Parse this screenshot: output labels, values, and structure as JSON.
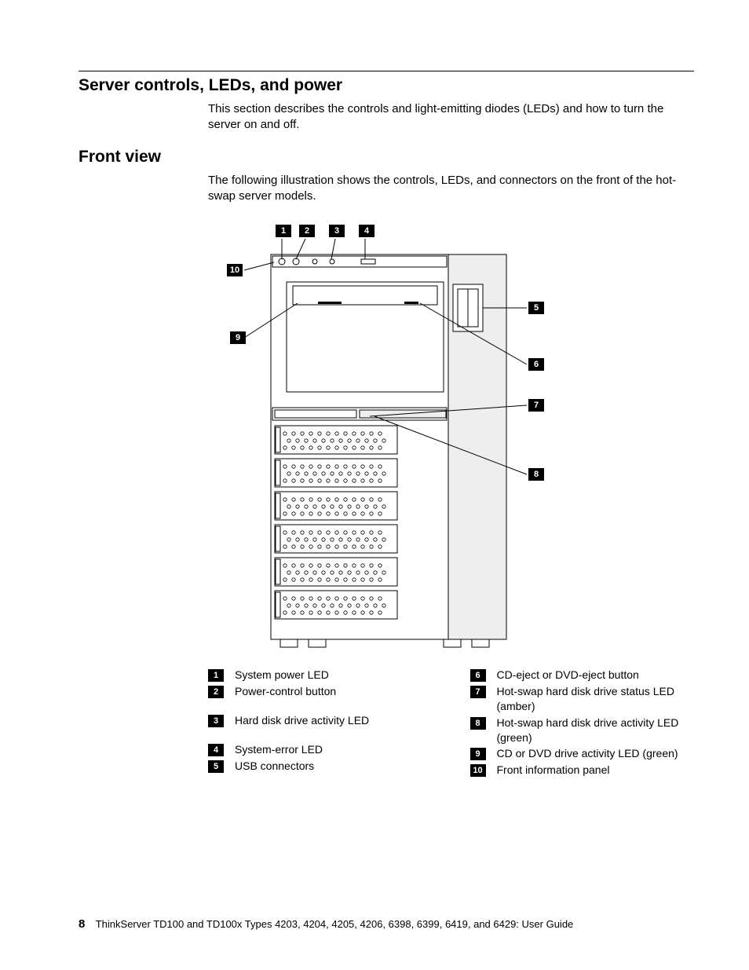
{
  "headings": {
    "h1": "Server controls, LEDs, and power",
    "h2": "Front view"
  },
  "paragraphs": {
    "p1": "This section describes the controls and light-emitting diodes (LEDs) and how to turn the server on and off.",
    "p2": "The following illustration shows the controls, LEDs, and connectors on the front of the hot-swap server models."
  },
  "callouts": {
    "c1": "1",
    "c2": "2",
    "c3": "3",
    "c4": "4",
    "c5": "5",
    "c6": "6",
    "c7": "7",
    "c8": "8",
    "c9": "9",
    "c10": "10"
  },
  "legend_left": [
    {
      "n": "1",
      "t": "System power LED"
    },
    {
      "n": "2",
      "t": "Power-control button"
    },
    {
      "n": "3",
      "t": "Hard disk drive activity LED"
    },
    {
      "n": "4",
      "t": "System-error LED"
    },
    {
      "n": "5",
      "t": "USB connectors"
    }
  ],
  "legend_right": [
    {
      "n": "6",
      "t": "CD-eject or DVD-eject button"
    },
    {
      "n": "7",
      "t": "Hot-swap hard disk drive status LED (amber)"
    },
    {
      "n": "8",
      "t": "Hot-swap hard disk drive activity LED (green)"
    },
    {
      "n": "9",
      "t": "CD or DVD drive activity LED (green)"
    },
    {
      "n": "10",
      "t": "Front information panel"
    }
  ],
  "footer": {
    "page": "8",
    "text": "ThinkServer TD100 and TD100x Types 4203, 4204, 4205, 4206, 6398, 6399, 6419, and 6429:  User Guide"
  }
}
